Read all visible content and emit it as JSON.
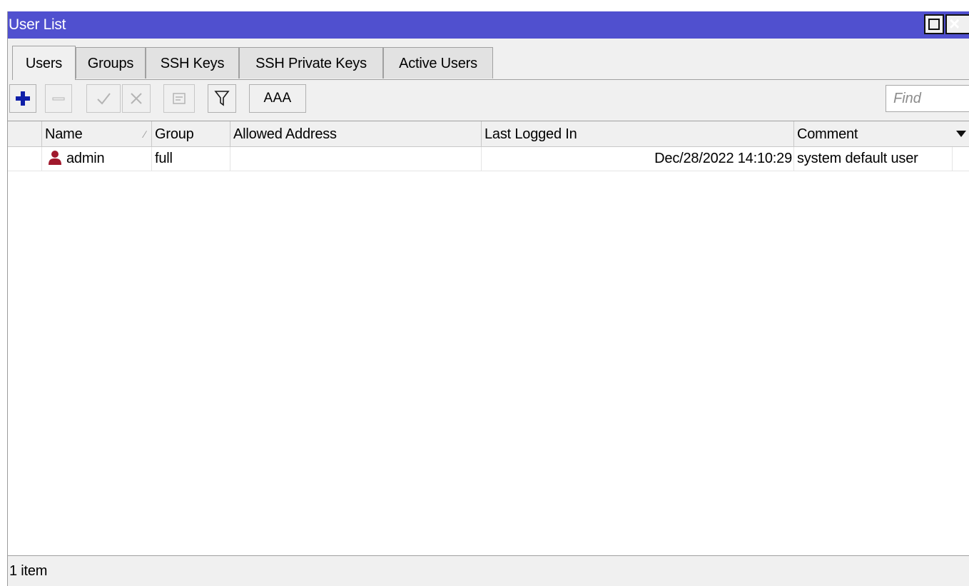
{
  "window": {
    "title": "User List",
    "close_label": "×"
  },
  "tabs": [
    {
      "label": "Users",
      "active": true
    },
    {
      "label": "Groups"
    },
    {
      "label": "SSH Keys"
    },
    {
      "label": "SSH Private Keys"
    },
    {
      "label": "Active Users"
    }
  ],
  "toolbar": {
    "aaa_label": "AAA",
    "find_placeholder": "Find"
  },
  "table": {
    "columns": [
      "Name",
      "Group",
      "Allowed Address",
      "Last Logged In",
      "Comment"
    ],
    "rows": [
      {
        "name": "admin",
        "group": "full",
        "allowed_address": "",
        "last_logged_in": "Dec/28/2022 14:10:29",
        "comment": "system default user"
      }
    ]
  },
  "status": {
    "text": "1 item"
  },
  "colors": {
    "titlebar": "#5050cf",
    "add_icon": "#0f1fa8",
    "user_icon": "#a0182c"
  }
}
